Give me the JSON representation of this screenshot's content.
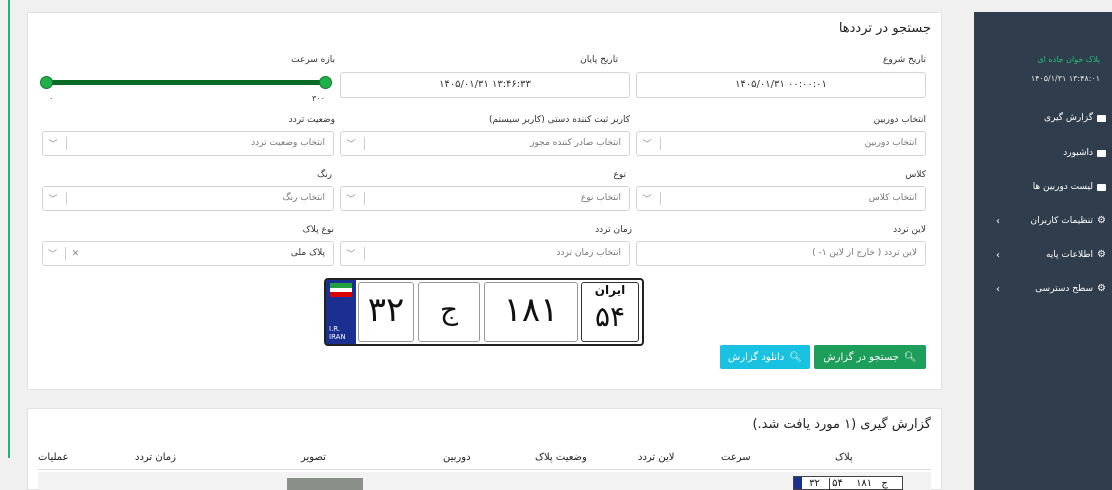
{
  "search_panel": {
    "title": "جستجو در ترددها",
    "start_date": {
      "label": "تاریخ شروع",
      "value": "۱۴۰۵/۰۱/۳۱ ۰۰:۰۰:۰۱"
    },
    "end_date": {
      "label": "تاریخ پایان",
      "value": "۱۴۰۵/۰۱/۳۱ ۱۳:۴۶:۳۳"
    },
    "speed_range": {
      "label": "بازه سرعت",
      "min_label": "۰",
      "max_label": "۳۰۰",
      "min_value": 0,
      "max_value": 300
    },
    "camera": {
      "label": "انتخاب دوربین",
      "placeholder": "انتخاب دوربین"
    },
    "manual_user": {
      "label": "کاربر ثبت کننده دستی (کاربر سیستم)",
      "placeholder": "انتخاب صادر کننده مجوز"
    },
    "status": {
      "label": "وضعیت تردد",
      "placeholder": "انتخاب وضعیت تردد"
    },
    "class": {
      "label": "کلاس",
      "placeholder": "انتخاب کلاس"
    },
    "type": {
      "label": "نوع",
      "placeholder": "انتخاب نوع"
    },
    "color": {
      "label": "رنگ",
      "placeholder": "انتخاب رنگ"
    },
    "lane": {
      "label": "لاین تردد",
      "placeholder": "لاین تردد ( خارج از لاین ۱- )"
    },
    "time": {
      "label": "زمان تردد",
      "placeholder": "انتخاب زمان تردد"
    },
    "plate_type": {
      "label": "نوع پلاک",
      "value": "پلاک ملی"
    },
    "plate": {
      "part1": "۳۲",
      "letter": "ج",
      "part2": "۱۸۱",
      "region_label": "ایران",
      "region": "۵۴",
      "ir_text": "I.R.",
      "iran_text": "IRAN"
    },
    "search_button": "جستجو در گزارش",
    "download_button": "دانلود گزارش"
  },
  "report_panel": {
    "title": "گزارش گیری (۱ مورد یافت شد.)",
    "columns": [
      "پلاک",
      "سرعت",
      "لاین تردد",
      "وضعیت پلاک",
      "دوربین",
      "تصویر",
      "زمان تردد",
      "عملیات"
    ],
    "row_plate": {
      "part1": "۳۲",
      "letter": "ج",
      "part2": "۱۸۱",
      "region": "۵۴"
    }
  },
  "sidebar": {
    "brand": "پلاک خوان جاده ای",
    "datetime": "۱۴۰۵/۱/۳۱ ۱۳:۴۸:۰۱",
    "items": [
      {
        "label": "گزارش گیری",
        "icon": "folder-icon"
      },
      {
        "label": "داشبورد",
        "icon": "folder-icon"
      },
      {
        "label": "لیست دوربین ها",
        "icon": "folder-icon"
      },
      {
        "label": "تنظیمات کاربران",
        "icon": "gear-icon"
      },
      {
        "label": "اطلاعات پایه",
        "icon": "gear-icon"
      },
      {
        "label": "سطح دسترسی",
        "icon": "gear-icon"
      }
    ]
  },
  "colors": {
    "accent": "#1d9e5a",
    "cyan": "#18c2e0",
    "sidebar": "#2f3d4c",
    "slider": "#0b6b26"
  }
}
